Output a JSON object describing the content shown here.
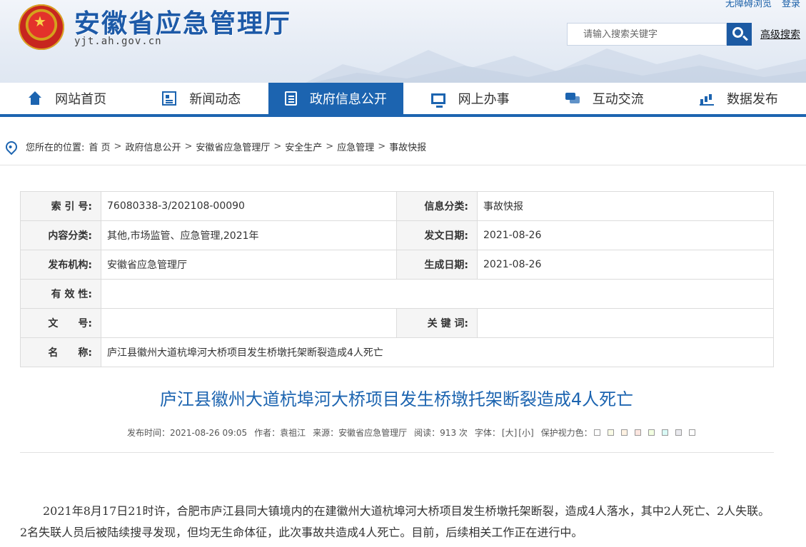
{
  "header": {
    "top_links": [
      "无障碍浏览",
      "登录"
    ],
    "site_title": "安徽省应急管理厅",
    "site_domain": "yjt.ah.gov.cn",
    "search_placeholder": "请输入搜索关键字",
    "advanced_search": "高级搜索"
  },
  "nav": {
    "items": [
      {
        "label": "网站首页",
        "icon": "home-icon"
      },
      {
        "label": "新闻动态",
        "icon": "news-icon"
      },
      {
        "label": "政府信息公开",
        "icon": "document-icon"
      },
      {
        "label": "网上办事",
        "icon": "monitor-icon"
      },
      {
        "label": "互动交流",
        "icon": "chat-icon"
      },
      {
        "label": "数据发布",
        "icon": "chart-icon"
      }
    ],
    "active_index": 2,
    "accent_color": "#1c64b0"
  },
  "breadcrumb": {
    "prefix": "您所在的位置:",
    "items": [
      "首 页",
      "政府信息公开",
      "安徽省应急管理厅",
      "安全生产",
      "应急管理",
      "事故快报"
    ],
    "separator": ">"
  },
  "info": {
    "index_label": "索 引 号:",
    "index_value": "76080338-3/202108-00090",
    "category_label": "信息分类:",
    "category_value": "事故快报",
    "content_label": "内容分类:",
    "content_value": "其他,市场监管、应急管理,2021年",
    "issue_date_label": "发文日期:",
    "issue_date_value": "2021-08-26",
    "publisher_label": "发布机构:",
    "publisher_value": "安徽省应急管理厅",
    "created_label": "生成日期:",
    "created_value": "2021-08-26",
    "validity_label": "有 效 性:",
    "validity_value": "",
    "docno_label": "文　　号:",
    "docno_value": "",
    "keywords_label": "关 键 词:",
    "keywords_value": "",
    "name_label": "名　　称:",
    "name_value": "庐江县徽州大道杭埠河大桥项目发生桥墩托架断裂造成4人死亡"
  },
  "article": {
    "title": "庐江县徽州大道杭埠河大桥项目发生桥墩托架断裂造成4人死亡",
    "publish_time": "发布时间：2021-08-26 09:05",
    "author": "作者：袁祖江",
    "source": "来源：安徽省应急管理厅",
    "views": "阅读：913 次",
    "font_label": "字体：",
    "font_large": "[大]",
    "font_small": "[小]",
    "eye_care_label": "保护视力色：",
    "eye_care_colors": [
      "#ffffff",
      "#fafbe6",
      "#fff2e2",
      "#fde6e0",
      "#f3ffe1",
      "#dafaf6",
      "#eaeaef",
      "#ffffff"
    ],
    "body": "2021年8月17日21时许，合肥市庐江县同大镇境内的在建徽州大道杭埠河大桥项目发生桥墩托架断裂，造成4人落水，其中2人死亡、2人失联。2名失联人员后被陆续搜寻发现，但均无生命体征，此次事故共造成4人死亡。目前，后续相关工作正在进行中。"
  }
}
